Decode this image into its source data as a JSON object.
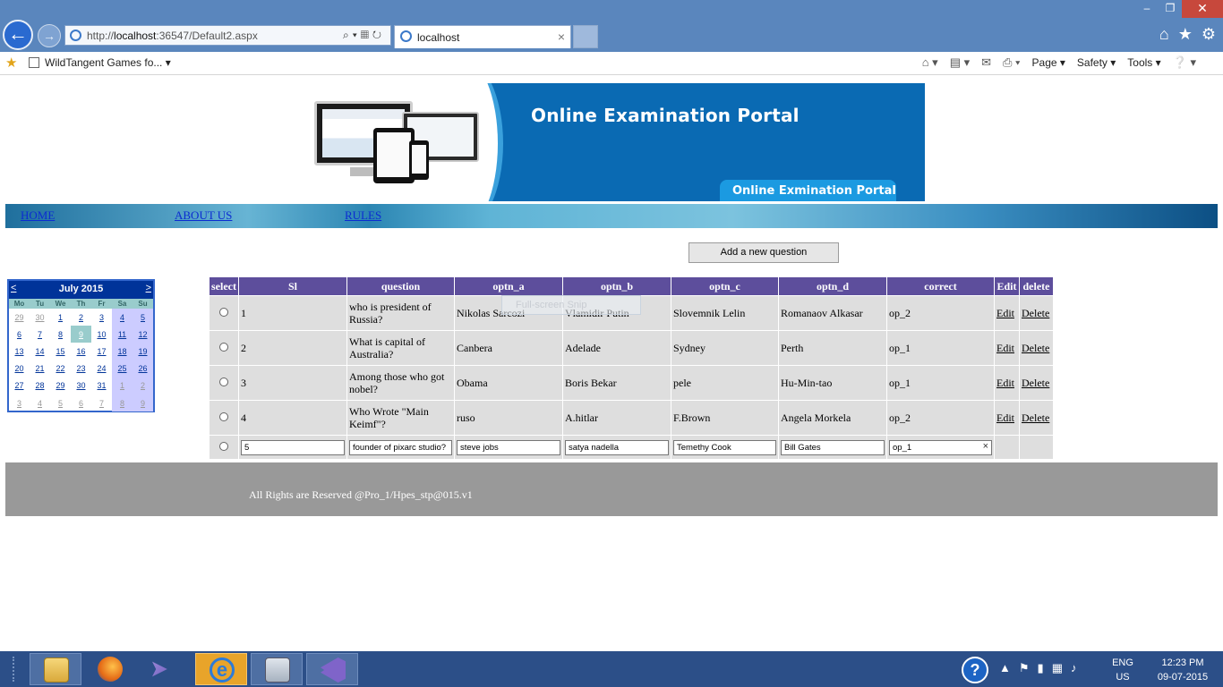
{
  "browser": {
    "url_prefix": "http://",
    "url_host": "localhost",
    "url_rest": ":36547/Default2.aspx",
    "tab_title": "localhost",
    "favorite": "WildTangent Games fo...",
    "cmd_page": "Page",
    "cmd_safety": "Safety",
    "cmd_tools": "Tools"
  },
  "banner": {
    "title": "Online Examination Portal",
    "badge": "Online Exmination Portal"
  },
  "menu": {
    "home": "HOME",
    "about": "ABOUT US",
    "rules": "RULES"
  },
  "actions": {
    "add_question": "Add a new question"
  },
  "snip_ghost": "Full-screen Snip",
  "calendar": {
    "prev": "<",
    "next": ">",
    "month": "July 2015",
    "weekdays": [
      "Mo",
      "Tu",
      "We",
      "Th",
      "Fr",
      "Sa",
      "Su"
    ],
    "weeks": [
      [
        "29",
        "30",
        "1",
        "2",
        "3",
        "4",
        "5"
      ],
      [
        "6",
        "7",
        "8",
        "9",
        "10",
        "11",
        "12"
      ],
      [
        "13",
        "14",
        "15",
        "16",
        "17",
        "18",
        "19"
      ],
      [
        "20",
        "21",
        "22",
        "23",
        "24",
        "25",
        "26"
      ],
      [
        "27",
        "28",
        "29",
        "30",
        "31",
        "1",
        "2"
      ],
      [
        "3",
        "4",
        "5",
        "6",
        "7",
        "8",
        "9"
      ]
    ],
    "selected_day": "9"
  },
  "grid": {
    "headers": [
      "select",
      "Sl",
      "question",
      "optn_a",
      "optn_b",
      "optn_c",
      "optn_d",
      "correct",
      "Edit",
      "delete"
    ],
    "rows": [
      {
        "sl": "1",
        "question": "who is president of Russia?",
        "a": "Nikolas Sarcozi",
        "b": "Vlamidir Putin",
        "c": "Slovemnik Lelin",
        "d": "Romanaov Alkasar",
        "correct": "op_2",
        "edit": "Edit",
        "delete": "Delete"
      },
      {
        "sl": "2",
        "question": "What is capital of Australia?",
        "a": "Canbera",
        "b": "Adelade",
        "c": "Sydney",
        "d": "Perth",
        "correct": "op_1",
        "edit": "Edit",
        "delete": "Delete"
      },
      {
        "sl": "3",
        "question": "Among those who got nobel?",
        "a": "Obama",
        "b": "Boris Bekar",
        "c": "pele",
        "d": "Hu-Min-tao",
        "correct": "op_1",
        "edit": "Edit",
        "delete": "Delete"
      },
      {
        "sl": "4",
        "question": "Who Wrote \"Main Keimf\"?",
        "a": "ruso",
        "b": "A.hitlar",
        "c": "F.Brown",
        "d": "Angela Morkela",
        "correct": "op_2",
        "edit": "Edit",
        "delete": "Delete"
      }
    ],
    "edit_row": {
      "sl": "5",
      "question": "founder of pixarc studio?",
      "a": "steve jobs",
      "b": "satya nadella",
      "c": "Temethy Cook",
      "d": "Bill Gates",
      "correct": "op_1"
    }
  },
  "footer": {
    "text": "All Rights are Reserved @Pro_1/Hpes_stp@015.v1"
  },
  "taskbar": {
    "lang": "ENG",
    "region": "US",
    "time": "12:23 PM",
    "date": "09-07-2015"
  },
  "colors": {
    "grid_header": "#5d4e9c",
    "grid_cell": "#dedede",
    "calendar_header": "#003399",
    "footer": "#999999",
    "banner": "#0a6ab3"
  }
}
